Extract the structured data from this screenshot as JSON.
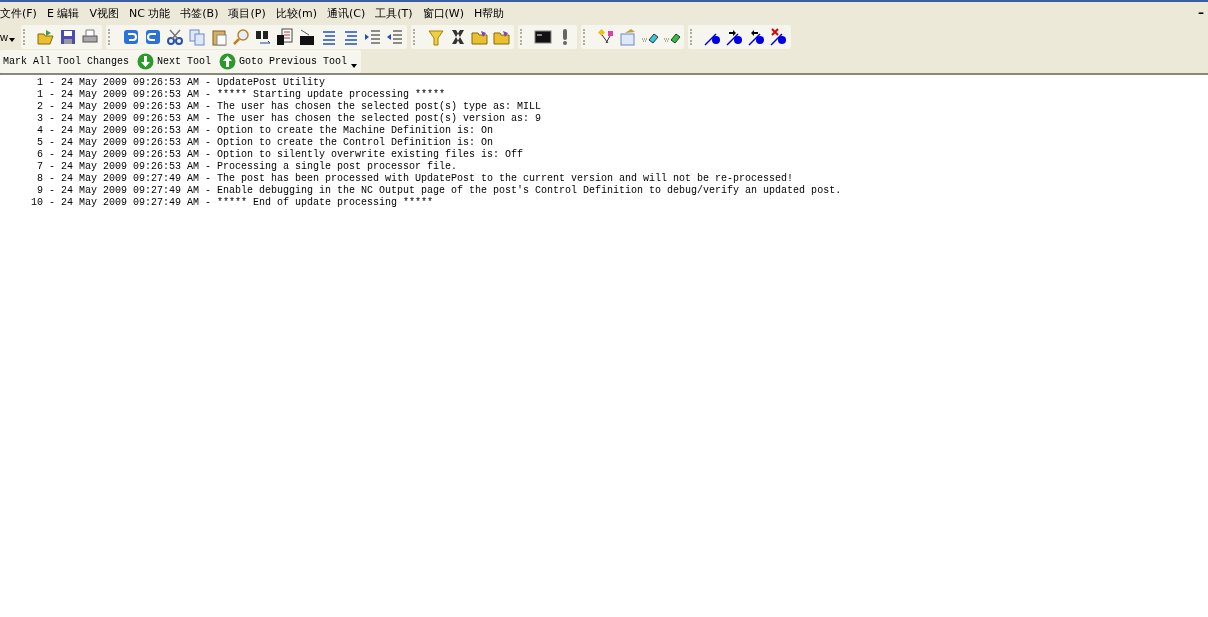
{
  "menu_bar": {
    "items": [
      {
        "label": "文件(F)"
      },
      {
        "label": "E 编辑"
      },
      {
        "label": "V视图"
      },
      {
        "label": "NC 功能"
      },
      {
        "label": "书签(B)"
      },
      {
        "label": "项目(P)"
      },
      {
        "label": "比较(m)"
      },
      {
        "label": "通讯(C)"
      },
      {
        "label": "工具(T)"
      },
      {
        "label": "窗口(W)"
      },
      {
        "label": "H帮助"
      }
    ],
    "minimize": "–"
  },
  "toolbar": {
    "cut_label": "w"
  },
  "tool_nav": {
    "buttons": [
      {
        "label": "Mark All Tool Changes",
        "kind": "text"
      },
      {
        "label": "Next Tool",
        "kind": "down"
      },
      {
        "label": "Goto Previous Tool",
        "kind": "up"
      }
    ]
  },
  "log": {
    "lines": [
      {
        "number": "1",
        "text": "- 24 May 2009 09:26:53 AM - UpdatePost Utility"
      },
      {
        "number": "1",
        "text": "- 24 May 2009 09:26:53 AM - ***** Starting update processing *****"
      },
      {
        "number": "2",
        "text": "- 24 May 2009 09:26:53 AM - The user has chosen the selected post(s) type as: MILL"
      },
      {
        "number": "3",
        "text": "- 24 May 2009 09:26:53 AM - The user has chosen the selected post(s) version as: 9"
      },
      {
        "number": "4",
        "text": "- 24 May 2009 09:26:53 AM - Option to create the Machine Definition is: On"
      },
      {
        "number": "5",
        "text": "- 24 May 2009 09:26:53 AM - Option to create the Control Definition is: On"
      },
      {
        "number": "6",
        "text": "- 24 May 2009 09:26:53 AM - Option to silently overwrite existing files is: Off"
      },
      {
        "number": "7",
        "text": "- 24 May 2009 09:26:53 AM - Processing a single post processor file."
      },
      {
        "number": "8",
        "text": "- 24 May 2009 09:27:49 AM - The post has been processed with UpdatePost to the current version and will not be re-processed!"
      },
      {
        "number": "9",
        "text": "- 24 May 2009 09:27:49 AM - Enable debugging in the NC Output page of the post's Control Definition to debug/verify an updated post."
      },
      {
        "number": "10",
        "text": "- 24 May 2009 09:27:49 AM - ***** End of update processing *****"
      }
    ]
  }
}
